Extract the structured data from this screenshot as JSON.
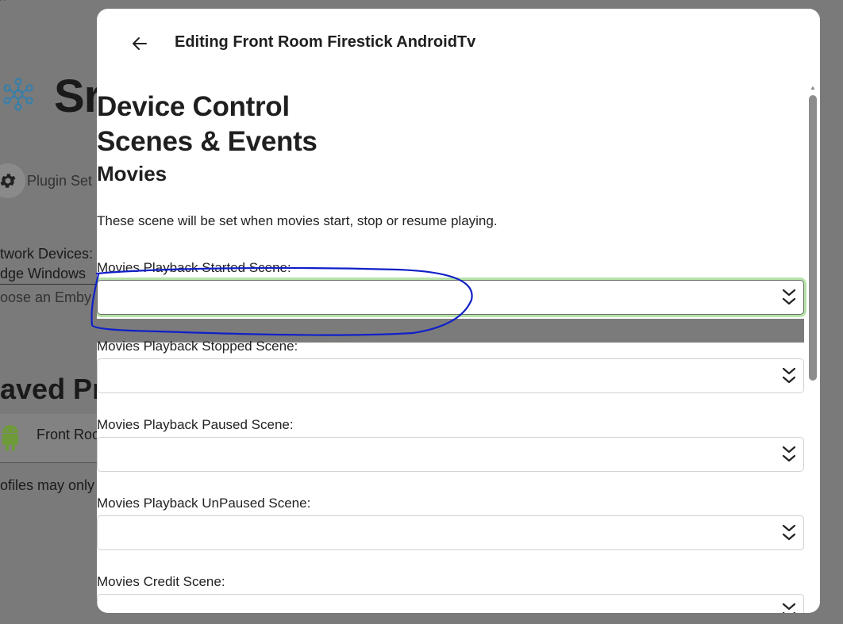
{
  "background": {
    "cursor_fragment": "^",
    "app_title_fragment": "Sr",
    "plugin_settings_label": "Plugin Set",
    "network_devices_label": "twork Devices:",
    "edge_label": "dge Windows",
    "choose_label": "oose an Emby",
    "saved_profiles_title": "aved Pr",
    "profile_name": "Front Roo",
    "profiles_note": "ofiles may only"
  },
  "modal": {
    "title": "Editing Front Room Firestick AndroidTv",
    "heading_device_control": "Device Control",
    "heading_scenes_events": "Scenes & Events",
    "section_movies": "Movies",
    "description": "These scene will be set when movies start, stop or resume playing.",
    "fields": [
      {
        "label": "Movies Playback Started Scene:",
        "value": ""
      },
      {
        "label": "Movies Playback Stopped Scene:",
        "value": ""
      },
      {
        "label": "Movies Playback Paused Scene:",
        "value": ""
      },
      {
        "label": "Movies Playback UnPaused Scene:",
        "value": ""
      },
      {
        "label": "Movies Credit Scene:",
        "value": ""
      }
    ]
  },
  "colors": {
    "annotation": "#1020c8",
    "focus_ring": "#b6e3a8",
    "android_green": "#7cb342",
    "logo_blue": "#3a7fa8"
  }
}
